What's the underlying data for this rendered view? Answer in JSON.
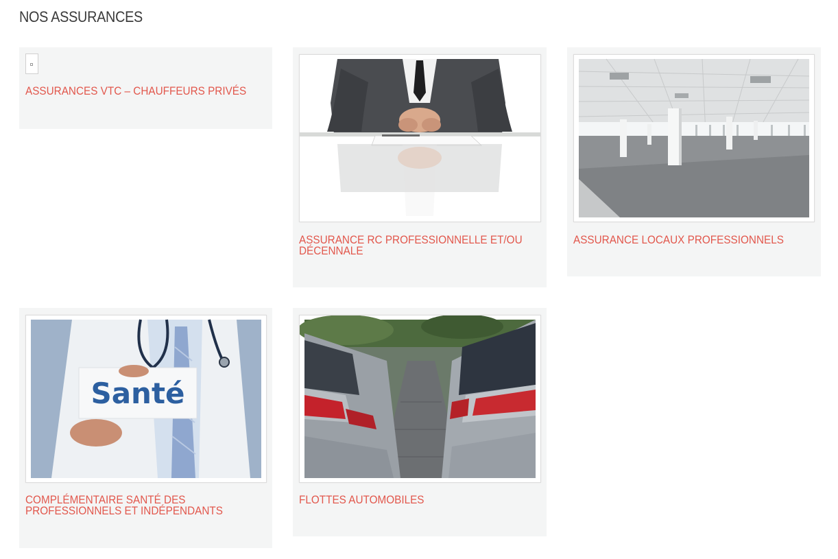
{
  "section": {
    "title": "NOS ASSURANCES"
  },
  "cards": [
    {
      "title": "ASSURANCES VTC – CHAUFFEURS PRIVÉS",
      "image": "broken-image-icon"
    },
    {
      "title": "ASSURANCE RC PROFESSIONNELLE ET/OU DÉCENNALE",
      "image": "businessman-hands-desk-photo"
    },
    {
      "title": "ASSURANCE LOCAUX PROFESSIONNELS",
      "image": "empty-office-space-photo"
    },
    {
      "title": "COMPLÉMENTAIRE SANTÉ DES PROFESSIONNELS ET INDÉPENDANTS",
      "image": "doctor-sante-card-photo",
      "image_text": "Santé"
    },
    {
      "title": "FLOTTES AUTOMOBILES",
      "image": "parked-cars-row-photo"
    }
  ],
  "colors": {
    "title": "#3a3a3a",
    "link": "#e2574c",
    "card_bg": "#f4f5f5"
  }
}
